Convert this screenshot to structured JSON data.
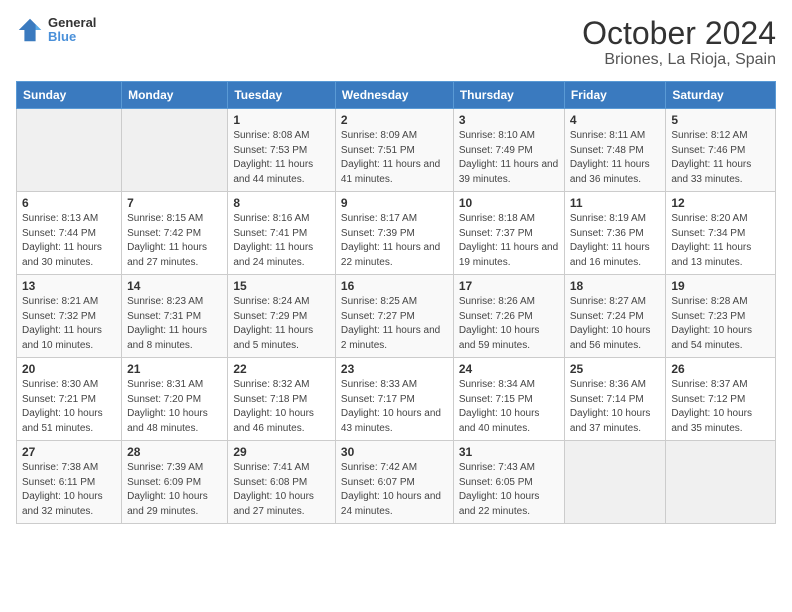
{
  "header": {
    "logo_line1": "General",
    "logo_line2": "Blue",
    "title": "October 2024",
    "subtitle": "Briones, La Rioja, Spain"
  },
  "weekdays": [
    "Sunday",
    "Monday",
    "Tuesday",
    "Wednesday",
    "Thursday",
    "Friday",
    "Saturday"
  ],
  "weeks": [
    [
      {
        "day": "",
        "info": ""
      },
      {
        "day": "",
        "info": ""
      },
      {
        "day": "1",
        "info": "Sunrise: 8:08 AM\nSunset: 7:53 PM\nDaylight: 11 hours and 44 minutes."
      },
      {
        "day": "2",
        "info": "Sunrise: 8:09 AM\nSunset: 7:51 PM\nDaylight: 11 hours and 41 minutes."
      },
      {
        "day": "3",
        "info": "Sunrise: 8:10 AM\nSunset: 7:49 PM\nDaylight: 11 hours and 39 minutes."
      },
      {
        "day": "4",
        "info": "Sunrise: 8:11 AM\nSunset: 7:48 PM\nDaylight: 11 hours and 36 minutes."
      },
      {
        "day": "5",
        "info": "Sunrise: 8:12 AM\nSunset: 7:46 PM\nDaylight: 11 hours and 33 minutes."
      }
    ],
    [
      {
        "day": "6",
        "info": "Sunrise: 8:13 AM\nSunset: 7:44 PM\nDaylight: 11 hours and 30 minutes."
      },
      {
        "day": "7",
        "info": "Sunrise: 8:15 AM\nSunset: 7:42 PM\nDaylight: 11 hours and 27 minutes."
      },
      {
        "day": "8",
        "info": "Sunrise: 8:16 AM\nSunset: 7:41 PM\nDaylight: 11 hours and 24 minutes."
      },
      {
        "day": "9",
        "info": "Sunrise: 8:17 AM\nSunset: 7:39 PM\nDaylight: 11 hours and 22 minutes."
      },
      {
        "day": "10",
        "info": "Sunrise: 8:18 AM\nSunset: 7:37 PM\nDaylight: 11 hours and 19 minutes."
      },
      {
        "day": "11",
        "info": "Sunrise: 8:19 AM\nSunset: 7:36 PM\nDaylight: 11 hours and 16 minutes."
      },
      {
        "day": "12",
        "info": "Sunrise: 8:20 AM\nSunset: 7:34 PM\nDaylight: 11 hours and 13 minutes."
      }
    ],
    [
      {
        "day": "13",
        "info": "Sunrise: 8:21 AM\nSunset: 7:32 PM\nDaylight: 11 hours and 10 minutes."
      },
      {
        "day": "14",
        "info": "Sunrise: 8:23 AM\nSunset: 7:31 PM\nDaylight: 11 hours and 8 minutes."
      },
      {
        "day": "15",
        "info": "Sunrise: 8:24 AM\nSunset: 7:29 PM\nDaylight: 11 hours and 5 minutes."
      },
      {
        "day": "16",
        "info": "Sunrise: 8:25 AM\nSunset: 7:27 PM\nDaylight: 11 hours and 2 minutes."
      },
      {
        "day": "17",
        "info": "Sunrise: 8:26 AM\nSunset: 7:26 PM\nDaylight: 10 hours and 59 minutes."
      },
      {
        "day": "18",
        "info": "Sunrise: 8:27 AM\nSunset: 7:24 PM\nDaylight: 10 hours and 56 minutes."
      },
      {
        "day": "19",
        "info": "Sunrise: 8:28 AM\nSunset: 7:23 PM\nDaylight: 10 hours and 54 minutes."
      }
    ],
    [
      {
        "day": "20",
        "info": "Sunrise: 8:30 AM\nSunset: 7:21 PM\nDaylight: 10 hours and 51 minutes."
      },
      {
        "day": "21",
        "info": "Sunrise: 8:31 AM\nSunset: 7:20 PM\nDaylight: 10 hours and 48 minutes."
      },
      {
        "day": "22",
        "info": "Sunrise: 8:32 AM\nSunset: 7:18 PM\nDaylight: 10 hours and 46 minutes."
      },
      {
        "day": "23",
        "info": "Sunrise: 8:33 AM\nSunset: 7:17 PM\nDaylight: 10 hours and 43 minutes."
      },
      {
        "day": "24",
        "info": "Sunrise: 8:34 AM\nSunset: 7:15 PM\nDaylight: 10 hours and 40 minutes."
      },
      {
        "day": "25",
        "info": "Sunrise: 8:36 AM\nSunset: 7:14 PM\nDaylight: 10 hours and 37 minutes."
      },
      {
        "day": "26",
        "info": "Sunrise: 8:37 AM\nSunset: 7:12 PM\nDaylight: 10 hours and 35 minutes."
      }
    ],
    [
      {
        "day": "27",
        "info": "Sunrise: 7:38 AM\nSunset: 6:11 PM\nDaylight: 10 hours and 32 minutes."
      },
      {
        "day": "28",
        "info": "Sunrise: 7:39 AM\nSunset: 6:09 PM\nDaylight: 10 hours and 29 minutes."
      },
      {
        "day": "29",
        "info": "Sunrise: 7:41 AM\nSunset: 6:08 PM\nDaylight: 10 hours and 27 minutes."
      },
      {
        "day": "30",
        "info": "Sunrise: 7:42 AM\nSunset: 6:07 PM\nDaylight: 10 hours and 24 minutes."
      },
      {
        "day": "31",
        "info": "Sunrise: 7:43 AM\nSunset: 6:05 PM\nDaylight: 10 hours and 22 minutes."
      },
      {
        "day": "",
        "info": ""
      },
      {
        "day": "",
        "info": ""
      }
    ]
  ]
}
